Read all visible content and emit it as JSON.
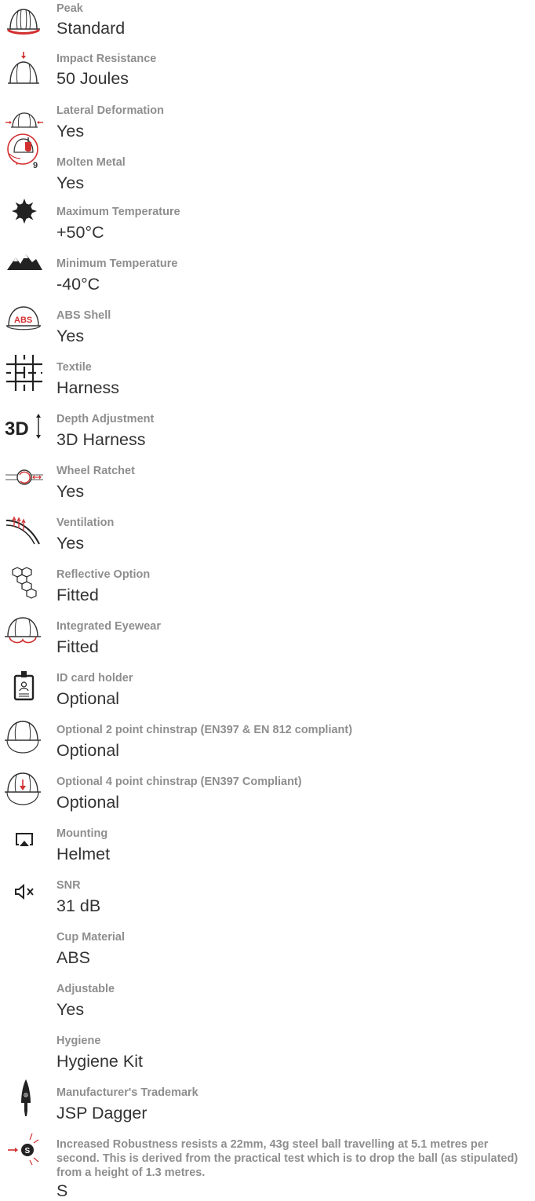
{
  "specs": [
    {
      "icon": "helmet-peak-icon",
      "label": "Peak",
      "value": "Standard"
    },
    {
      "icon": "impact-resistance-icon",
      "label": "Impact Resistance",
      "value": "50 Joules"
    },
    {
      "icon": "lateral-deformation-icon",
      "label": "Lateral Deformation",
      "value": "Yes"
    },
    {
      "icon": "molten-metal-icon",
      "label": "Molten Metal",
      "value": "Yes"
    },
    {
      "icon": "sun-icon",
      "label": "Maximum Temperature",
      "value": "+50°C"
    },
    {
      "icon": "mountains-icon",
      "label": "Minimum Temperature",
      "value": "-40°C"
    },
    {
      "icon": "abs-shell-icon",
      "label": "ABS Shell",
      "value": "Yes"
    },
    {
      "icon": "textile-icon",
      "label": "Textile",
      "value": "Harness"
    },
    {
      "icon": "3d-depth-icon",
      "label": "Depth Adjustment",
      "value": "3D Harness"
    },
    {
      "icon": "wheel-ratchet-icon",
      "label": "Wheel Ratchet",
      "value": "Yes"
    },
    {
      "icon": "ventilation-icon",
      "label": "Ventilation",
      "value": "Yes"
    },
    {
      "icon": "reflective-hexagon-icon",
      "label": "Reflective Option",
      "value": "Fitted"
    },
    {
      "icon": "integrated-eyewear-icon",
      "label": "Integrated Eyewear",
      "value": "Fitted"
    },
    {
      "icon": "id-card-holder-icon",
      "label": "ID card holder",
      "value": "Optional"
    },
    {
      "icon": "chinstrap-2-point-icon",
      "label": "Optional 2 point chinstrap (EN397 & EN 812 compliant)",
      "value": "Optional"
    },
    {
      "icon": "chinstrap-4-point-icon",
      "label": "Optional 4 point chinstrap (EN397 Compliant)",
      "value": "Optional"
    },
    {
      "icon": "mounting-icon",
      "label": "Mounting",
      "value": "Helmet"
    },
    {
      "icon": "mute-speaker-icon",
      "label": "SNR",
      "value": "31 dB"
    },
    {
      "icon": "",
      "label": "Cup Material",
      "value": "ABS"
    },
    {
      "icon": "",
      "label": "Adjustable",
      "value": "Yes"
    },
    {
      "icon": "",
      "label": "Hygiene",
      "value": "Hygiene Kit"
    },
    {
      "icon": "dagger-trademark-icon",
      "label": "Manufacturer's Trademark",
      "value": "JSP Dagger"
    },
    {
      "icon": "robustness-s-icon",
      "label": "Increased Robustness resists a 22mm, 43g steel ball travelling at 5.1 metres per second. This is derived from the practical test which is to drop the ball (as stipulated) from a height of 1.3 metres.",
      "value": "S"
    }
  ],
  "colors": {
    "label": "#8e8e8e",
    "value": "#333333",
    "accent_red": "#d32f2f",
    "icon_dark": "#222222"
  }
}
